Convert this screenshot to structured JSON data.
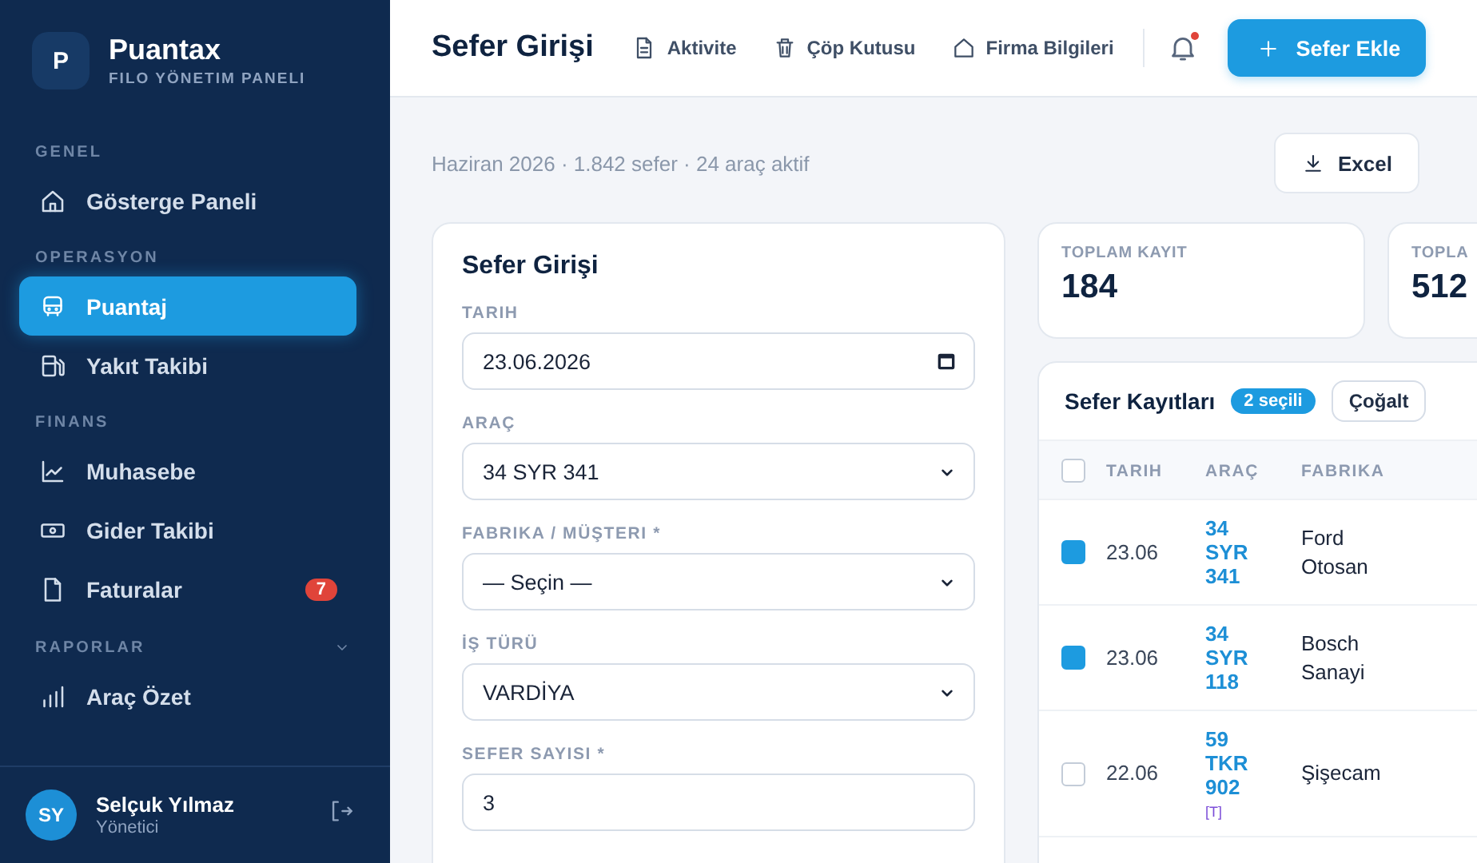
{
  "sidebar": {
    "brand": {
      "logo_letter": "P",
      "name": "Puantax",
      "tagline": "FILO YÖNETIM PANELI"
    },
    "sections": [
      {
        "title": "GENEL",
        "items": [
          {
            "label": "Gösterge Paneli",
            "selected": false
          }
        ]
      },
      {
        "title": "OPERASYON",
        "items": [
          {
            "label": "Puantaj",
            "selected": true
          },
          {
            "label": "Yakıt Takibi",
            "selected": false
          }
        ]
      },
      {
        "title": "FINANS",
        "items": [
          {
            "label": "Muhasebe",
            "selected": false
          },
          {
            "label": "Gider Takibi",
            "selected": false
          },
          {
            "label": "Faturalar",
            "selected": false,
            "badge": "7"
          }
        ]
      },
      {
        "title": "RAPORLAR",
        "expanded": true,
        "items": [
          {
            "label": "Araç Özet",
            "selected": false
          }
        ]
      }
    ],
    "user": {
      "initials": "SY",
      "name": "Selçuk Yılmaz",
      "role": "Yönetici"
    }
  },
  "header": {
    "title": "Sefer Girişi",
    "links": [
      "Aktivite",
      "Çöp Kutusu",
      "Firma Bilgileri"
    ],
    "notifications_unread": true,
    "primary_button": "Sefer Ekle"
  },
  "summary": "Haziran 2026 · 1.842 sefer · 24 araç aktif",
  "export_button": "Excel",
  "form": {
    "title": "Sefer Girişi",
    "fields": [
      {
        "label": "TARIH",
        "kind": "date",
        "value": "23.06.2026"
      },
      {
        "label": "ARAÇ",
        "kind": "select",
        "value": "34 SYR 341"
      },
      {
        "label": "FABRIKA / MÜŞTERI *",
        "kind": "select",
        "value": "— Seçin —"
      },
      {
        "label": "İŞ TÜRÜ",
        "kind": "select",
        "value": "VARDİYA"
      },
      {
        "label": "SEFER SAYISI *",
        "kind": "number",
        "value": "3"
      }
    ]
  },
  "stats": [
    {
      "label": "TOPLAM KAYIT",
      "value": "184"
    },
    {
      "label": "TOPLA",
      "value": "512"
    }
  ],
  "table": {
    "title": "Sefer Kayıtları",
    "selection_badge": "2 seçili",
    "actions": [
      "Çoğalt"
    ],
    "all_selected": false,
    "columns": [
      "TARIH",
      "ARAÇ",
      "FABRIKA"
    ],
    "rows": [
      {
        "selected": true,
        "date": "23.06",
        "vehicle": "34 SYR 341",
        "factory": "Ford Otosan"
      },
      {
        "selected": true,
        "date": "23.06",
        "vehicle": "34 SYR 118",
        "factory": "Bosch Sanayi"
      },
      {
        "selected": false,
        "date": "22.06",
        "vehicle": "59 TKR 902",
        "tag": "[T]",
        "factory": "Şişecam"
      }
    ]
  }
}
